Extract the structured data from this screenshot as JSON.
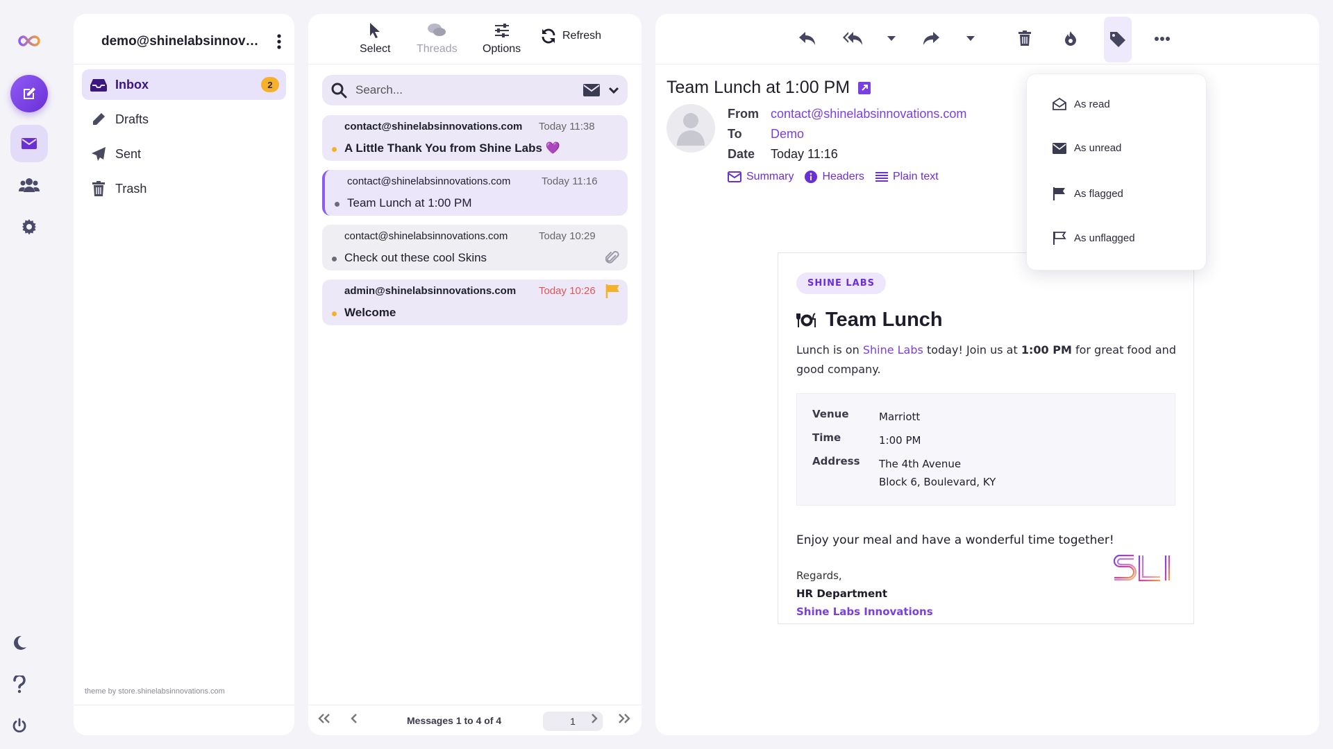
{
  "account": {
    "email": "demo@shinelabsinnovatio..."
  },
  "folders": [
    {
      "label": "Inbox",
      "icon": "inbox-icon",
      "badge": "2",
      "active": true
    },
    {
      "label": "Drafts",
      "icon": "pencil-icon"
    },
    {
      "label": "Sent",
      "icon": "paper-plane-icon"
    },
    {
      "label": "Trash",
      "icon": "trash-icon"
    }
  ],
  "theme_credit": "theme by store.shinelabsinnovations.com",
  "list_toolbar": {
    "select": "Select",
    "threads": "Threads",
    "options": "Options",
    "refresh": "Refresh"
  },
  "search": {
    "placeholder": "Search..."
  },
  "messages": [
    {
      "from": "contact@shinelabsinnovations.com",
      "date": "Today 11:38",
      "subject": "A Little Thank You from Shine Labs 💜",
      "unread": true
    },
    {
      "from": "contact@shinelabsinnovations.com",
      "date": "Today 11:16",
      "subject": "Team Lunch at 1:00 PM",
      "selected": true
    },
    {
      "from": "contact@shinelabsinnovations.com",
      "date": "Today 10:29",
      "subject": "Check out these cool Skins",
      "attachment": true
    },
    {
      "from": "admin@shinelabsinnovations.com",
      "date": "Today 10:26",
      "subject": "Welcome",
      "unread": true,
      "flagged": true
    }
  ],
  "pager": {
    "count": "Messages 1 to 4 of 4",
    "page": "1"
  },
  "reader": {
    "subject": "Team Lunch at 1:00 PM",
    "from_label": "From",
    "from": "contact@shinelabsinnovations.com",
    "to_label": "To",
    "to": "Demo",
    "date_label": "Date",
    "date": "Today 11:16",
    "links": {
      "summary": "Summary",
      "headers": "Headers",
      "plain": "Plain text"
    }
  },
  "email": {
    "tag": "SHINE LABS",
    "title": "Team Lunch",
    "intro": {
      "p1": "Lunch is on ",
      "brand": "Shine Labs",
      "p2": " today! Join us at ",
      "time": "1:00 PM",
      "p3": " for great food and good company."
    },
    "details": [
      {
        "k": "Venue",
        "v": "Marriott"
      },
      {
        "k": "Time",
        "v": "1:00 PM"
      },
      {
        "k": "Address",
        "v": "The 4th Avenue",
        "v2": "Block 6, Boulevard, KY"
      }
    ],
    "enjoy": "Enjoy your meal and have a wonderful time together!",
    "regards": "Regards,",
    "dept": "HR Department",
    "company": "Shine Labs Innovations"
  },
  "mark_menu": [
    "As read",
    "As unread",
    "As flagged",
    "As unflagged"
  ],
  "colors": {
    "accent": "#6b2fd6",
    "accent_light": "#e8e2fa",
    "badge": "#f6b12a",
    "flag": "#f6b12a"
  }
}
